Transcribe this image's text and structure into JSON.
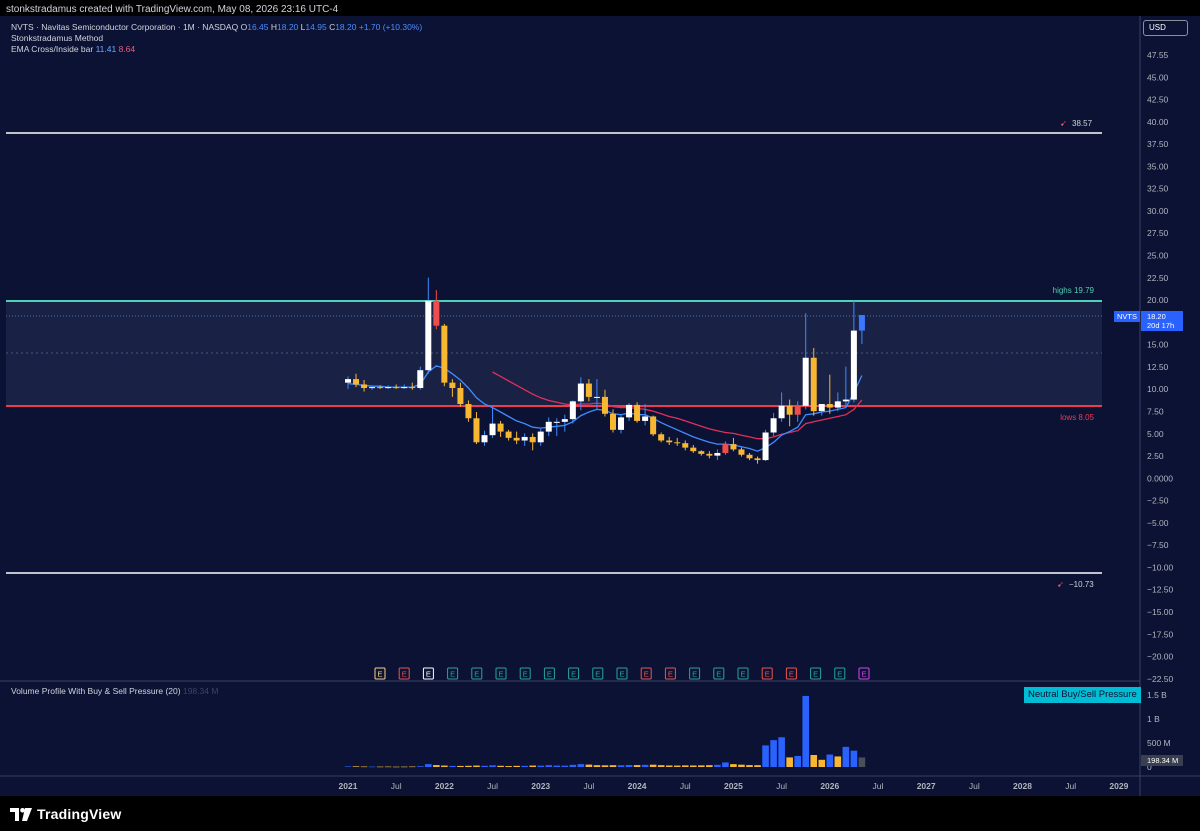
{
  "header": {
    "caption": "stonkstradamus created with TradingView.com, May 08, 2026 23:16 UTC-4"
  },
  "legend": {
    "line1_prefix": "NVTS · Navitas Semiconductor Corporation · 1M · NASDAQ",
    "o_label": "O",
    "o_value": "16.45",
    "h_label": "H",
    "h_value": "18.20",
    "l_label": "L",
    "l_value": "14.95",
    "c_label": "C",
    "c_value": "18.20",
    "change": "+1.70 (+10.30%)",
    "indicator1": "Stonkstradamus Method",
    "indicator2_label": "EMA Cross/Inside bar",
    "ema_fast": "11.41",
    "ema_slow": "8.64"
  },
  "currency": "USD",
  "price_axis": {
    "ticks": [
      "47.55",
      "45.00",
      "42.50",
      "40.00",
      "37.50",
      "35.00",
      "32.50",
      "30.00",
      "27.50",
      "25.00",
      "22.50",
      "20.00",
      "17.50",
      "15.00",
      "12.50",
      "10.00",
      "7.50",
      "5.00",
      "2.50",
      "0.0000",
      "−2.50",
      "−5.00",
      "−7.50",
      "−10.00",
      "−12.50",
      "−15.00",
      "−17.50",
      "−20.00",
      "−22.50"
    ]
  },
  "levels": {
    "upper_label": "38.57",
    "highs_label": "highs  19.79",
    "lows_label": "lows  8.05",
    "lower_label": "−10.73",
    "ticker_tag": "NVTS",
    "price_tag": "18.20",
    "countdown_tag": "20d 17h"
  },
  "earnings_markers": [
    "E",
    "E",
    "E",
    "E",
    "E",
    "E",
    "E",
    "E",
    "E",
    "E",
    "E",
    "E",
    "E",
    "E",
    "E",
    "E",
    "E",
    "E",
    "E",
    "E",
    "E"
  ],
  "volume_panel": {
    "title": "Volume Profile With Buy & Sell Pressure (20)",
    "title_value": "198.34 M",
    "badge": "Neutral Buy/Sell Pressure",
    "axis_ticks": [
      "1.5 B",
      "1 B",
      "500 M",
      "0"
    ],
    "current_tag": "198.34 M"
  },
  "time_axis": {
    "labels": [
      "2021",
      "Jul",
      "2022",
      "Jul",
      "2023",
      "Jul",
      "2024",
      "Jul",
      "2025",
      "Jul",
      "2026",
      "Jul",
      "2027",
      "Jul",
      "2028",
      "Jul",
      "2029"
    ]
  },
  "footer": {
    "brand": "TradingView"
  },
  "colors": {
    "background": "#0b1234",
    "bull_candle": "#ffffff",
    "bear_candle": "#f7b733",
    "red_candle": "#ef4d4d",
    "blue_candle": "#3b78ff",
    "highs_line": "#4fd1b5",
    "lows_line": "#ef3b4f",
    "ema_fast": "#3f8cff",
    "ema_slow": "#e0305a",
    "volume_blue": "#2962ff",
    "volume_yellow": "#f7b733"
  },
  "chart_data": {
    "type": "candlestick",
    "symbol": "NVTS",
    "timeframe": "1M",
    "ylim": [
      -22.5,
      47.55
    ],
    "horizontal_levels": [
      38.57,
      19.79,
      8.05,
      -10.73
    ],
    "candles": [
      {
        "t": "2021-01",
        "o": 10.6,
        "h": 11.3,
        "l": 9.9,
        "c": 11.0
      },
      {
        "t": "2021-02",
        "o": 11.0,
        "h": 11.6,
        "l": 10.1,
        "c": 10.4
      },
      {
        "t": "2021-03",
        "o": 10.4,
        "h": 10.9,
        "l": 9.6,
        "c": 10.0
      },
      {
        "t": "2021-04",
        "o": 10.0,
        "h": 10.3,
        "l": 9.8,
        "c": 10.1
      },
      {
        "t": "2021-05",
        "o": 10.1,
        "h": 10.3,
        "l": 9.9,
        "c": 10.0
      },
      {
        "t": "2021-06",
        "o": 10.0,
        "h": 10.3,
        "l": 9.9,
        "c": 10.1
      },
      {
        "t": "2021-07",
        "o": 10.1,
        "h": 10.4,
        "l": 9.9,
        "c": 10.0
      },
      {
        "t": "2021-08",
        "o": 10.0,
        "h": 10.4,
        "l": 9.9,
        "c": 10.1
      },
      {
        "t": "2021-09",
        "o": 10.1,
        "h": 10.6,
        "l": 9.8,
        "c": 10.0
      },
      {
        "t": "2021-10",
        "o": 10.0,
        "h": 12.4,
        "l": 9.8,
        "c": 12.0
      },
      {
        "t": "2021-11",
        "o": 12.0,
        "h": 22.4,
        "l": 11.6,
        "c": 19.8
      },
      {
        "t": "2021-12",
        "o": 19.8,
        "h": 21.0,
        "l": 16.6,
        "c": 17.0
      },
      {
        "t": "2022-01",
        "o": 17.0,
        "h": 17.2,
        "l": 10.2,
        "c": 10.6
      },
      {
        "t": "2022-02",
        "o": 10.6,
        "h": 11.0,
        "l": 9.0,
        "c": 10.0
      },
      {
        "t": "2022-03",
        "o": 10.0,
        "h": 10.6,
        "l": 7.9,
        "c": 8.2
      },
      {
        "t": "2022-04",
        "o": 8.2,
        "h": 8.6,
        "l": 6.2,
        "c": 6.6
      },
      {
        "t": "2022-05",
        "o": 6.6,
        "h": 7.3,
        "l": 3.7,
        "c": 3.9
      },
      {
        "t": "2022-06",
        "o": 3.9,
        "h": 5.2,
        "l": 3.5,
        "c": 4.7
      },
      {
        "t": "2022-07",
        "o": 4.7,
        "h": 7.8,
        "l": 4.4,
        "c": 6.0
      },
      {
        "t": "2022-08",
        "o": 6.0,
        "h": 6.3,
        "l": 4.5,
        "c": 5.1
      },
      {
        "t": "2022-09",
        "o": 5.1,
        "h": 5.3,
        "l": 4.1,
        "c": 4.4
      },
      {
        "t": "2022-10",
        "o": 4.4,
        "h": 5.1,
        "l": 3.7,
        "c": 4.1
      },
      {
        "t": "2022-11",
        "o": 4.1,
        "h": 4.9,
        "l": 3.5,
        "c": 4.5
      },
      {
        "t": "2022-12",
        "o": 4.5,
        "h": 4.9,
        "l": 3.0,
        "c": 3.9
      },
      {
        "t": "2023-01",
        "o": 3.9,
        "h": 5.4,
        "l": 3.5,
        "c": 5.1
      },
      {
        "t": "2023-02",
        "o": 5.1,
        "h": 6.7,
        "l": 4.6,
        "c": 6.2
      },
      {
        "t": "2023-03",
        "o": 6.2,
        "h": 6.6,
        "l": 4.6,
        "c": 6.2
      },
      {
        "t": "2023-04",
        "o": 6.2,
        "h": 7.0,
        "l": 5.1,
        "c": 6.5
      },
      {
        "t": "2023-05",
        "o": 6.5,
        "h": 8.6,
        "l": 6.0,
        "c": 8.5
      },
      {
        "t": "2023-06",
        "o": 8.5,
        "h": 11.2,
        "l": 7.5,
        "c": 10.5
      },
      {
        "t": "2023-07",
        "o": 10.5,
        "h": 11.0,
        "l": 8.5,
        "c": 9.0
      },
      {
        "t": "2023-08",
        "o": 9.0,
        "h": 11.0,
        "l": 7.6,
        "c": 9.0
      },
      {
        "t": "2023-09",
        "o": 9.0,
        "h": 9.8,
        "l": 6.8,
        "c": 7.1
      },
      {
        "t": "2023-10",
        "o": 7.1,
        "h": 7.6,
        "l": 5.0,
        "c": 5.3
      },
      {
        "t": "2023-11",
        "o": 5.3,
        "h": 7.0,
        "l": 4.9,
        "c": 6.7
      },
      {
        "t": "2023-12",
        "o": 6.7,
        "h": 8.3,
        "l": 6.3,
        "c": 8.1
      },
      {
        "t": "2024-01",
        "o": 8.1,
        "h": 8.4,
        "l": 6.1,
        "c": 6.3
      },
      {
        "t": "2024-02",
        "o": 6.3,
        "h": 8.2,
        "l": 5.8,
        "c": 6.8
      },
      {
        "t": "2024-03",
        "o": 6.8,
        "h": 6.9,
        "l": 4.6,
        "c": 4.8
      },
      {
        "t": "2024-04",
        "o": 4.8,
        "h": 5.0,
        "l": 3.9,
        "c": 4.1
      },
      {
        "t": "2024-05",
        "o": 4.1,
        "h": 4.5,
        "l": 3.6,
        "c": 3.9
      },
      {
        "t": "2024-06",
        "o": 3.9,
        "h": 4.4,
        "l": 3.5,
        "c": 3.8
      },
      {
        "t": "2024-07",
        "o": 3.8,
        "h": 4.1,
        "l": 3.0,
        "c": 3.3
      },
      {
        "t": "2024-08",
        "o": 3.3,
        "h": 3.6,
        "l": 2.7,
        "c": 2.9
      },
      {
        "t": "2024-09",
        "o": 2.9,
        "h": 3.0,
        "l": 2.4,
        "c": 2.6
      },
      {
        "t": "2024-10",
        "o": 2.6,
        "h": 2.9,
        "l": 2.1,
        "c": 2.4
      },
      {
        "t": "2024-11",
        "o": 2.4,
        "h": 3.1,
        "l": 1.9,
        "c": 2.7
      },
      {
        "t": "2024-12",
        "o": 2.7,
        "h": 4.0,
        "l": 2.5,
        "c": 3.7
      },
      {
        "t": "2025-01",
        "o": 3.7,
        "h": 4.4,
        "l": 2.9,
        "c": 3.1
      },
      {
        "t": "2025-02",
        "o": 3.1,
        "h": 3.3,
        "l": 2.3,
        "c": 2.5
      },
      {
        "t": "2025-03",
        "o": 2.5,
        "h": 2.7,
        "l": 1.9,
        "c": 2.1
      },
      {
        "t": "2025-04",
        "o": 2.1,
        "h": 2.3,
        "l": 1.5,
        "c": 1.9
      },
      {
        "t": "2025-05",
        "o": 1.9,
        "h": 5.3,
        "l": 1.8,
        "c": 5.0
      },
      {
        "t": "2025-06",
        "o": 5.0,
        "h": 7.2,
        "l": 4.6,
        "c": 6.6
      },
      {
        "t": "2025-07",
        "o": 6.6,
        "h": 9.5,
        "l": 6.2,
        "c": 8.0
      },
      {
        "t": "2025-08",
        "o": 8.0,
        "h": 8.7,
        "l": 5.7,
        "c": 7.0
      },
      {
        "t": "2025-09",
        "o": 7.0,
        "h": 8.5,
        "l": 6.2,
        "c": 8.0
      },
      {
        "t": "2025-10",
        "o": 8.0,
        "h": 18.4,
        "l": 7.6,
        "c": 13.4
      },
      {
        "t": "2025-11",
        "o": 13.4,
        "h": 14.5,
        "l": 6.9,
        "c": 7.4
      },
      {
        "t": "2025-12",
        "o": 7.4,
        "h": 8.2,
        "l": 6.9,
        "c": 8.2
      },
      {
        "t": "2026-01",
        "o": 8.2,
        "h": 11.5,
        "l": 7.1,
        "c": 7.8
      },
      {
        "t": "2026-02",
        "o": 7.8,
        "h": 9.5,
        "l": 7.4,
        "c": 8.5
      },
      {
        "t": "2026-03",
        "o": 8.5,
        "h": 12.4,
        "l": 7.8,
        "c": 8.7
      },
      {
        "t": "2026-04",
        "o": 8.7,
        "h": 19.8,
        "l": 8.4,
        "c": 16.45
      },
      {
        "t": "2026-05",
        "o": 16.45,
        "h": 18.2,
        "l": 14.95,
        "c": 18.2
      }
    ],
    "ema_fast": [
      10.5,
      10.4,
      10.3,
      10.2,
      10.2,
      10.1,
      10.1,
      10.1,
      10.1,
      10.4,
      11.8,
      12.5,
      12.2,
      11.6,
      10.9,
      10.0,
      8.9,
      8.2,
      7.8,
      7.3,
      6.8,
      6.3,
      6.0,
      5.6,
      5.5,
      5.6,
      5.7,
      5.8,
      6.2,
      6.9,
      7.3,
      7.6,
      7.5,
      7.1,
      7.0,
      7.2,
      7.0,
      7.0,
      6.6,
      6.1,
      5.7,
      5.3,
      4.9,
      4.5,
      4.2,
      3.9,
      3.7,
      3.7,
      3.6,
      3.4,
      3.2,
      2.9,
      3.3,
      3.9,
      4.7,
      5.1,
      5.6,
      7.0,
      7.1,
      7.3,
      7.4,
      7.6,
      7.8,
      9.5,
      11.41
    ],
    "ema_slow": [
      null,
      null,
      null,
      null,
      null,
      null,
      null,
      null,
      null,
      null,
      null,
      null,
      null,
      null,
      null,
      null,
      null,
      null,
      11.8,
      11.3,
      10.8,
      10.3,
      9.8,
      9.3,
      8.9,
      8.6,
      8.4,
      8.2,
      8.1,
      8.2,
      8.2,
      8.3,
      8.2,
      7.9,
      7.8,
      7.8,
      7.7,
      7.6,
      7.4,
      7.1,
      6.8,
      6.6,
      6.3,
      6.0,
      5.7,
      5.4,
      5.2,
      5.0,
      4.9,
      4.7,
      4.5,
      4.3,
      4.3,
      4.5,
      4.8,
      5.0,
      5.2,
      6.0,
      6.2,
      6.4,
      6.6,
      6.8,
      7.0,
      7.6,
      8.64
    ],
    "volume_M": [
      {
        "v": 12,
        "c": "blue"
      },
      {
        "v": 14,
        "c": "yellow"
      },
      {
        "v": 10,
        "c": "yellow"
      },
      {
        "v": 8,
        "c": "blue"
      },
      {
        "v": 8,
        "c": "yellow"
      },
      {
        "v": 9,
        "c": "yellow"
      },
      {
        "v": 7,
        "c": "yellow"
      },
      {
        "v": 8,
        "c": "yellow"
      },
      {
        "v": 10,
        "c": "yellow"
      },
      {
        "v": 16,
        "c": "blue"
      },
      {
        "v": 60,
        "c": "blue"
      },
      {
        "v": 40,
        "c": "yellow"
      },
      {
        "v": 30,
        "c": "yellow"
      },
      {
        "v": 22,
        "c": "blue"
      },
      {
        "v": 22,
        "c": "yellow"
      },
      {
        "v": 25,
        "c": "yellow"
      },
      {
        "v": 30,
        "c": "yellow"
      },
      {
        "v": 25,
        "c": "blue"
      },
      {
        "v": 35,
        "c": "blue"
      },
      {
        "v": 25,
        "c": "yellow"
      },
      {
        "v": 20,
        "c": "yellow"
      },
      {
        "v": 24,
        "c": "yellow"
      },
      {
        "v": 24,
        "c": "blue"
      },
      {
        "v": 30,
        "c": "yellow"
      },
      {
        "v": 28,
        "c": "blue"
      },
      {
        "v": 38,
        "c": "blue"
      },
      {
        "v": 30,
        "c": "blue"
      },
      {
        "v": 28,
        "c": "blue"
      },
      {
        "v": 45,
        "c": "blue"
      },
      {
        "v": 60,
        "c": "blue"
      },
      {
        "v": 50,
        "c": "yellow"
      },
      {
        "v": 38,
        "c": "yellow"
      },
      {
        "v": 35,
        "c": "yellow"
      },
      {
        "v": 38,
        "c": "yellow"
      },
      {
        "v": 36,
        "c": "blue"
      },
      {
        "v": 42,
        "c": "blue"
      },
      {
        "v": 40,
        "c": "yellow"
      },
      {
        "v": 45,
        "c": "blue"
      },
      {
        "v": 48,
        "c": "yellow"
      },
      {
        "v": 38,
        "c": "yellow"
      },
      {
        "v": 32,
        "c": "yellow"
      },
      {
        "v": 30,
        "c": "yellow"
      },
      {
        "v": 34,
        "c": "yellow"
      },
      {
        "v": 32,
        "c": "yellow"
      },
      {
        "v": 34,
        "c": "yellow"
      },
      {
        "v": 38,
        "c": "yellow"
      },
      {
        "v": 45,
        "c": "blue"
      },
      {
        "v": 95,
        "c": "blue"
      },
      {
        "v": 60,
        "c": "yellow"
      },
      {
        "v": 48,
        "c": "yellow"
      },
      {
        "v": 40,
        "c": "yellow"
      },
      {
        "v": 38,
        "c": "yellow"
      },
      {
        "v": 450,
        "c": "blue"
      },
      {
        "v": 560,
        "c": "blue"
      },
      {
        "v": 620,
        "c": "blue"
      },
      {
        "v": 200,
        "c": "yellow"
      },
      {
        "v": 230,
        "c": "blue"
      },
      {
        "v": 1480,
        "c": "blue"
      },
      {
        "v": 250,
        "c": "yellow"
      },
      {
        "v": 150,
        "c": "yellow"
      },
      {
        "v": 260,
        "c": "blue"
      },
      {
        "v": 220,
        "c": "yellow"
      },
      {
        "v": 420,
        "c": "blue"
      },
      {
        "v": 340,
        "c": "blue"
      },
      {
        "v": 198.34,
        "c": "gray"
      }
    ],
    "volume_ylim": [
      0,
      1650
    ]
  }
}
